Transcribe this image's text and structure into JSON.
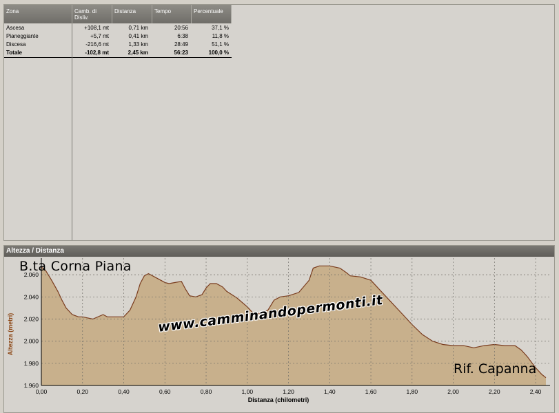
{
  "table": {
    "columns": [
      "Zona",
      "Camb. di Disliv.",
      "Distanza",
      "Tempo",
      "Percentuale"
    ],
    "rows": [
      {
        "zona": "Ascesa",
        "disliv": "+108,1 mt",
        "distanza": "0,71 km",
        "tempo": "20:56",
        "perc": "37,1 %"
      },
      {
        "zona": "Pianeggiante",
        "disliv": "+5,7 mt",
        "distanza": "0,41 km",
        "tempo": "6:38",
        "perc": "11,8 %"
      },
      {
        "zona": "Discesa",
        "disliv": "-216,6 mt",
        "distanza": "1,33 km",
        "tempo": "28:49",
        "perc": "51,1 %"
      }
    ],
    "total": {
      "zona": "Totale",
      "disliv": "-102,8 mt",
      "distanza": "2,45 km",
      "tempo": "56:23",
      "perc": "100,0 %"
    }
  },
  "chart": {
    "header": "Altezza / Distanza",
    "start_label": "B.ta Corna Piana",
    "end_label": "Rif. Capanna",
    "watermark": "www.camminandopermonti.it"
  },
  "chart_data": {
    "type": "area",
    "xlabel": "Distanza (chilometri)",
    "ylabel": "Altezza (metri)",
    "xlim": [
      0,
      2.47
    ],
    "ylim": [
      1960,
      2075
    ],
    "xticks": [
      "0,00",
      "0,20",
      "0,40",
      "0,60",
      "0,80",
      "1,00",
      "1,20",
      "1,40",
      "1,60",
      "1,80",
      "2,00",
      "2,20",
      "2,40"
    ],
    "yticks": [
      "2.060",
      "2.040",
      "2.020",
      "2.000",
      "1.980",
      "1.960"
    ],
    "grid": true,
    "colors": {
      "fill": "#c8b08c",
      "line": "#7a3c1e"
    },
    "x": [
      0.0,
      0.02,
      0.05,
      0.08,
      0.1,
      0.12,
      0.15,
      0.18,
      0.2,
      0.25,
      0.3,
      0.32,
      0.35,
      0.4,
      0.43,
      0.46,
      0.48,
      0.5,
      0.52,
      0.55,
      0.58,
      0.6,
      0.62,
      0.65,
      0.68,
      0.7,
      0.72,
      0.75,
      0.78,
      0.8,
      0.82,
      0.85,
      0.88,
      0.9,
      0.95,
      1.0,
      1.03,
      1.06,
      1.1,
      1.13,
      1.16,
      1.2,
      1.25,
      1.3,
      1.32,
      1.35,
      1.4,
      1.45,
      1.48,
      1.5,
      1.55,
      1.6,
      1.65,
      1.7,
      1.75,
      1.8,
      1.85,
      1.9,
      1.95,
      2.0,
      2.05,
      2.1,
      2.15,
      2.2,
      2.25,
      2.3,
      2.33,
      2.36,
      2.4,
      2.43,
      2.45
    ],
    "values": [
      2067,
      2064,
      2055,
      2045,
      2037,
      2030,
      2024,
      2022,
      2022,
      2020,
      2024,
      2022,
      2022,
      2022,
      2028,
      2040,
      2052,
      2059,
      2061,
      2058,
      2055,
      2053,
      2052,
      2053,
      2054,
      2047,
      2041,
      2040,
      2042,
      2048,
      2052,
      2052,
      2049,
      2045,
      2039,
      2031,
      2025,
      2025,
      2028,
      2037,
      2040,
      2041,
      2044,
      2055,
      2066,
      2068,
      2068,
      2066,
      2062,
      2059,
      2058,
      2055,
      2045,
      2035,
      2025,
      2015,
      2006,
      2000,
      1997,
      1996,
      1996,
      1994,
      1996,
      1997,
      1996,
      1996,
      1992,
      1986,
      1976,
      1970,
      1967
    ]
  }
}
